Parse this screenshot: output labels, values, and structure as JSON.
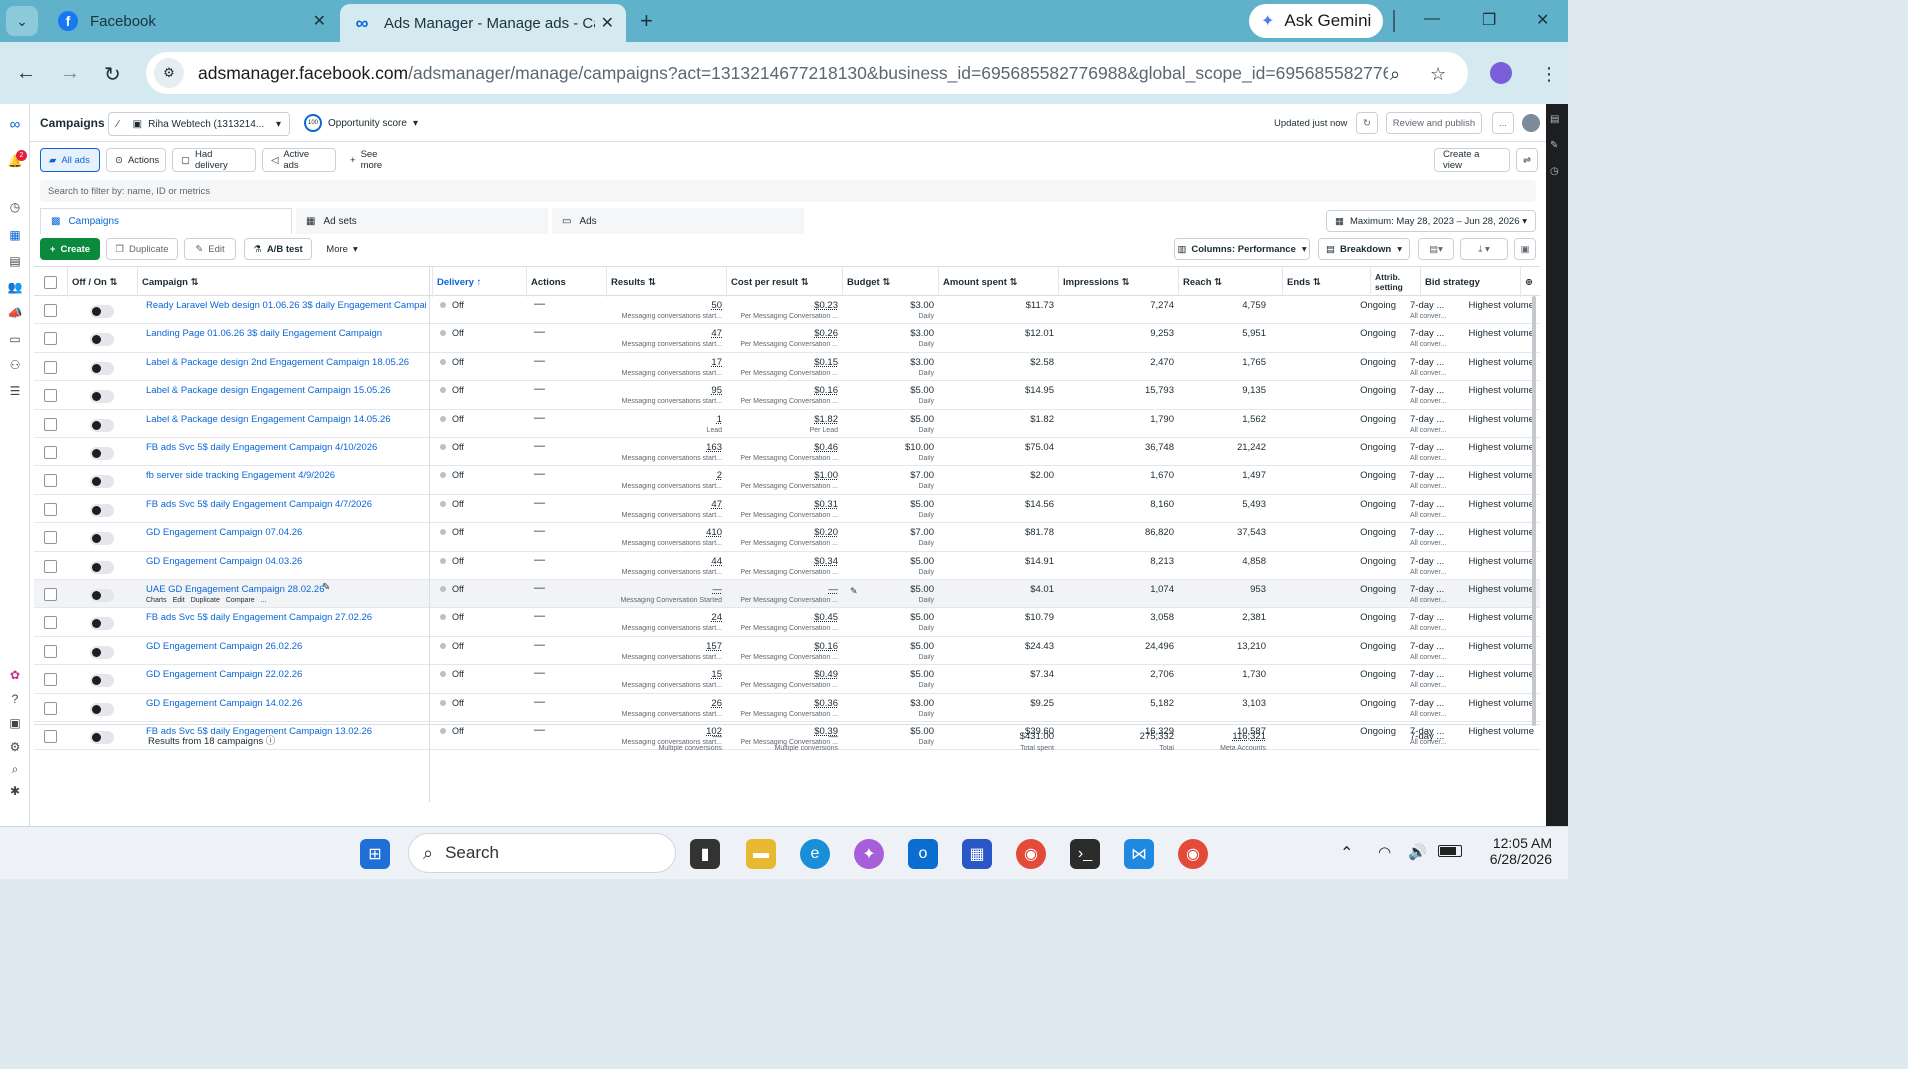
{
  "browser": {
    "tabs": [
      {
        "title": "Facebook"
      },
      {
        "title": "Ads Manager - Manage ads - Ca"
      }
    ],
    "ask_gemini": "Ask Gemini",
    "url_host": "adsmanager.facebook.com",
    "url_path": "/adsmanager/manage/campaigns?act=1313214677218130&business_id=695685582776988&global_scope_id=695685582776..."
  },
  "header": {
    "title": "Campaigns",
    "account": "Riha Webtech (1313214...",
    "opportunity": "Opportunity score",
    "opportunity_value": "100",
    "updated": "Updated just now",
    "review_publish": "Review and publish",
    "more": "...",
    "notif_count": "2"
  },
  "filters": {
    "chips": [
      "All ads",
      "Actions",
      "Had delivery",
      "Active ads",
      "See more"
    ],
    "create_view": "Create a view",
    "search_placeholder": "Search to filter by: name, ID or metrics"
  },
  "levels": {
    "tabs": [
      "Campaigns",
      "Ad sets",
      "Ads"
    ],
    "date_range": "Maximum: May 28, 2023 – Jun 28, 2026"
  },
  "toolbar": {
    "create": "Create",
    "duplicate": "Duplicate",
    "edit": "Edit",
    "ab_test": "A/B test",
    "more": "More",
    "columns": "Columns: Performance",
    "breakdown": "Breakdown"
  },
  "columns": [
    "Off / On",
    "Campaign",
    "Delivery",
    "Actions",
    "Results",
    "Cost per result",
    "Budget",
    "Amount spent",
    "Impressions",
    "Reach",
    "Ends",
    "Attrib. setting",
    "Bid strategy"
  ],
  "rows": [
    {
      "name": "Ready Laravel Web design 01.06.26 3$ daily Engagement Campai...",
      "delivery": "Off",
      "actions": "—",
      "results": "50",
      "results_sub": "Messaging conversations start...",
      "cpr": "$0.23",
      "cpr_sub": "Per Messaging Conversation ...",
      "budget": "$3.00",
      "budget_sub": "Daily",
      "spent": "$11.73",
      "impr": "7,274",
      "reach": "4,759",
      "ends": "Ongoing",
      "attr": "7-day ...",
      "attr_sub": "All conver...",
      "bid": "Highest volume"
    },
    {
      "name": "Landing Page 01.06.26 3$ daily Engagement Campaign",
      "delivery": "Off",
      "actions": "—",
      "results": "47",
      "results_sub": "Messaging conversations start...",
      "cpr": "$0.26",
      "cpr_sub": "Per Messaging Conversation ...",
      "budget": "$3.00",
      "budget_sub": "Daily",
      "spent": "$12.01",
      "impr": "9,253",
      "reach": "5,951",
      "ends": "Ongoing",
      "attr": "7-day ...",
      "attr_sub": "All conver...",
      "bid": "Highest volume"
    },
    {
      "name": "Label & Package design 2nd Engagement Campaign 18.05.26",
      "delivery": "Off",
      "actions": "—",
      "results": "17",
      "results_sub": "Messaging conversations start...",
      "cpr": "$0.15",
      "cpr_sub": "Per Messaging Conversation ...",
      "budget": "$3.00",
      "budget_sub": "Daily",
      "spent": "$2.58",
      "impr": "2,470",
      "reach": "1,765",
      "ends": "Ongoing",
      "attr": "7-day ...",
      "attr_sub": "All conver...",
      "bid": "Highest volume"
    },
    {
      "name": "Label & Package design Engagement Campaign 15.05.26",
      "delivery": "Off",
      "actions": "—",
      "results": "95",
      "results_sub": "Messaging conversations start...",
      "cpr": "$0.16",
      "cpr_sub": "Per Messaging Conversation ...",
      "budget": "$5.00",
      "budget_sub": "Daily",
      "spent": "$14.95",
      "impr": "15,793",
      "reach": "9,135",
      "ends": "Ongoing",
      "attr": "7-day ...",
      "attr_sub": "All conver...",
      "bid": "Highest volume"
    },
    {
      "name": "Label & Package design Engagement Campaign 14.05.26",
      "delivery": "Off",
      "actions": "—",
      "results": "1",
      "results_sub": "Lead",
      "cpr": "$1.82",
      "cpr_sub": "Per Lead",
      "budget": "$5.00",
      "budget_sub": "Daily",
      "spent": "$1.82",
      "impr": "1,790",
      "reach": "1,562",
      "ends": "Ongoing",
      "attr": "7-day ...",
      "attr_sub": "All conver...",
      "bid": "Highest volume"
    },
    {
      "name": "FB ads Svc 5$ daily Engagement Campaign 4/10/2026",
      "delivery": "Off",
      "actions": "—",
      "results": "163",
      "results_sub": "Messaging conversations start...",
      "cpr": "$0.46",
      "cpr_sub": "Per Messaging Conversation ...",
      "budget": "$10.00",
      "budget_sub": "Daily",
      "spent": "$75.04",
      "impr": "36,748",
      "reach": "21,242",
      "ends": "Ongoing",
      "attr": "7-day ...",
      "attr_sub": "All conver...",
      "bid": "Highest volume"
    },
    {
      "name": "fb server side tracking Engagement 4/9/2026",
      "delivery": "Off",
      "actions": "—",
      "results": "2",
      "results_sub": "Messaging conversations start...",
      "cpr": "$1.00",
      "cpr_sub": "Per Messaging Conversation ...",
      "budget": "$7.00",
      "budget_sub": "Daily",
      "spent": "$2.00",
      "impr": "1,670",
      "reach": "1,497",
      "ends": "Ongoing",
      "attr": "7-day ...",
      "attr_sub": "All conver...",
      "bid": "Highest volume"
    },
    {
      "name": "FB ads Svc 5$ daily Engagement Campaign 4/7/2026",
      "delivery": "Off",
      "actions": "—",
      "results": "47",
      "results_sub": "Messaging conversations start...",
      "cpr": "$0.31",
      "cpr_sub": "Per Messaging Conversation ...",
      "budget": "$5.00",
      "budget_sub": "Daily",
      "spent": "$14.56",
      "impr": "8,160",
      "reach": "5,493",
      "ends": "Ongoing",
      "attr": "7-day ...",
      "attr_sub": "All conver...",
      "bid": "Highest volume"
    },
    {
      "name": "GD Engagement Campaign 07.04.26",
      "delivery": "Off",
      "actions": "—",
      "results": "410",
      "results_sub": "Messaging conversations start...",
      "cpr": "$0.20",
      "cpr_sub": "Per Messaging Conversation ...",
      "budget": "$7.00",
      "budget_sub": "Daily",
      "spent": "$81.78",
      "impr": "86,820",
      "reach": "37,543",
      "ends": "Ongoing",
      "attr": "7-day ...",
      "attr_sub": "All conver...",
      "bid": "Highest volume"
    },
    {
      "name": "GD Engagement Campaign 04.03.26",
      "delivery": "Off",
      "actions": "—",
      "results": "44",
      "results_sub": "Messaging conversations start...",
      "cpr": "$0.34",
      "cpr_sub": "Per Messaging Conversation ...",
      "budget": "$5.00",
      "budget_sub": "Daily",
      "spent": "$14.91",
      "impr": "8,213",
      "reach": "4,858",
      "ends": "Ongoing",
      "attr": "7-day ...",
      "attr_sub": "All conver...",
      "bid": "Highest volume"
    },
    {
      "name": "UAE GD Engagement Campaign 28.02.26",
      "delivery": "Off",
      "actions": "—",
      "results": "—",
      "results_sub": "Messaging Conversation Started",
      "cpr": "—",
      "cpr_sub": "Per Messaging Conversation ...",
      "budget": "$5.00",
      "budget_sub": "Daily",
      "spent": "$4.01",
      "impr": "1,074",
      "reach": "953",
      "ends": "Ongoing",
      "attr": "7-day ...",
      "attr_sub": "All conver...",
      "bid": "Highest volume",
      "hover": true
    },
    {
      "name": "FB ads Svc 5$ daily Engagement Campaign 27.02.26",
      "delivery": "Off",
      "actions": "—",
      "results": "24",
      "results_sub": "Messaging conversations start...",
      "cpr": "$0.45",
      "cpr_sub": "Per Messaging Conversation ...",
      "budget": "$5.00",
      "budget_sub": "Daily",
      "spent": "$10.79",
      "impr": "3,058",
      "reach": "2,381",
      "ends": "Ongoing",
      "attr": "7-day ...",
      "attr_sub": "All conver...",
      "bid": "Highest volume"
    },
    {
      "name": "GD Engagement Campaign 26.02.26",
      "delivery": "Off",
      "actions": "—",
      "results": "157",
      "results_sub": "Messaging conversations start...",
      "cpr": "$0.16",
      "cpr_sub": "Per Messaging Conversation ...",
      "budget": "$5.00",
      "budget_sub": "Daily",
      "spent": "$24.43",
      "impr": "24,496",
      "reach": "13,210",
      "ends": "Ongoing",
      "attr": "7-day ...",
      "attr_sub": "All conver...",
      "bid": "Highest volume"
    },
    {
      "name": "GD Engagement Campaign 22.02.26",
      "delivery": "Off",
      "actions": "—",
      "results": "15",
      "results_sub": "Messaging conversations start...",
      "cpr": "$0.49",
      "cpr_sub": "Per Messaging Conversation ...",
      "budget": "$5.00",
      "budget_sub": "Daily",
      "spent": "$7.34",
      "impr": "2,706",
      "reach": "1,730",
      "ends": "Ongoing",
      "attr": "7-day ...",
      "attr_sub": "All conver...",
      "bid": "Highest volume"
    },
    {
      "name": "GD Engagement Campaign 14.02.26",
      "delivery": "Off",
      "actions": "—",
      "results": "26",
      "results_sub": "Messaging conversations start...",
      "cpr": "$0.36",
      "cpr_sub": "Per Messaging Conversation ...",
      "budget": "$3.00",
      "budget_sub": "Daily",
      "spent": "$9.25",
      "impr": "5,182",
      "reach": "3,103",
      "ends": "Ongoing",
      "attr": "7-day ...",
      "attr_sub": "All conver...",
      "bid": "Highest volume"
    },
    {
      "name": "FB ads Svc 5$ daily Engagement Campaign 13.02.26",
      "delivery": "Off",
      "actions": "—",
      "results": "102",
      "results_sub": "Messaging conversations start...",
      "cpr": "$0.39",
      "cpr_sub": "Per Messaging Conversation ...",
      "budget": "$5.00",
      "budget_sub": "Daily",
      "spent": "$39.60",
      "impr": "16,329",
      "reach": "10,587",
      "ends": "Ongoing",
      "attr": "7-day ...",
      "attr_sub": "All conver...",
      "bid": "Highest volume"
    }
  ],
  "row_actions": [
    "Charts",
    "Edit",
    "Duplicate",
    "Compare",
    "..."
  ],
  "totals": {
    "label": "Results from 18 campaigns",
    "results": "—",
    "results_sub": "Multiple conversions",
    "cpr": "—",
    "cpr_sub": "Multiple conversions",
    "spent": "$431.00",
    "spent_sub": "Total spent",
    "impr": "275,332",
    "impr_sub": "Total",
    "reach": "116,321",
    "reach_sub": "Meta Accounts",
    "attr": "7-day ..."
  },
  "taskbar": {
    "search": "Search",
    "time": "12:05 AM",
    "date": "6/28/2026"
  },
  "colors": {
    "accent": "#0a66d8",
    "create_green": "#0b8a3d",
    "chrome_tab": "#5fb2c9"
  }
}
